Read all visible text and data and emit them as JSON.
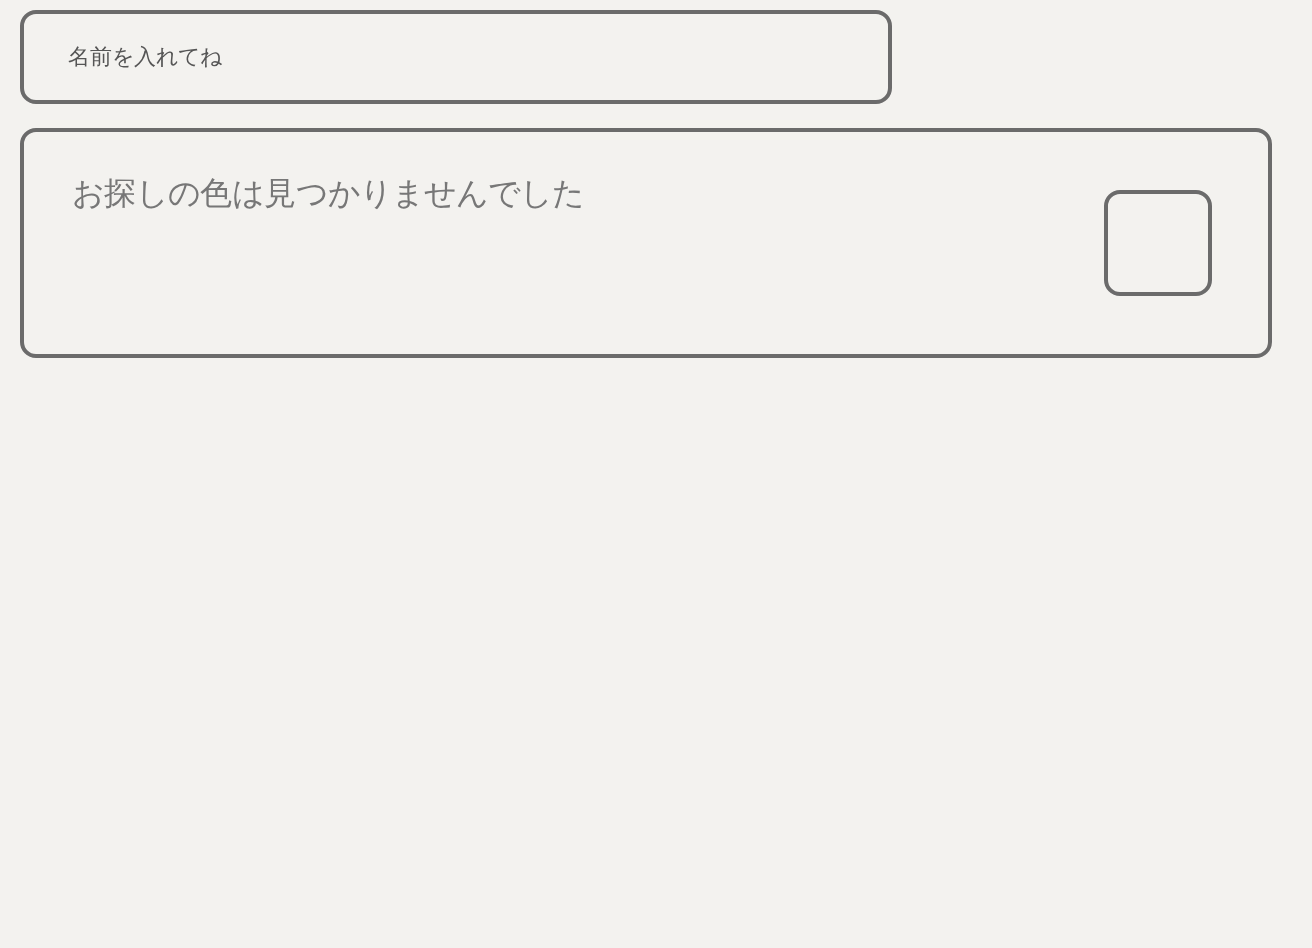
{
  "name_field": {
    "placeholder": "名前を入れてね"
  },
  "result_card": {
    "message": "お探しの色は見つかりませんでした"
  }
}
